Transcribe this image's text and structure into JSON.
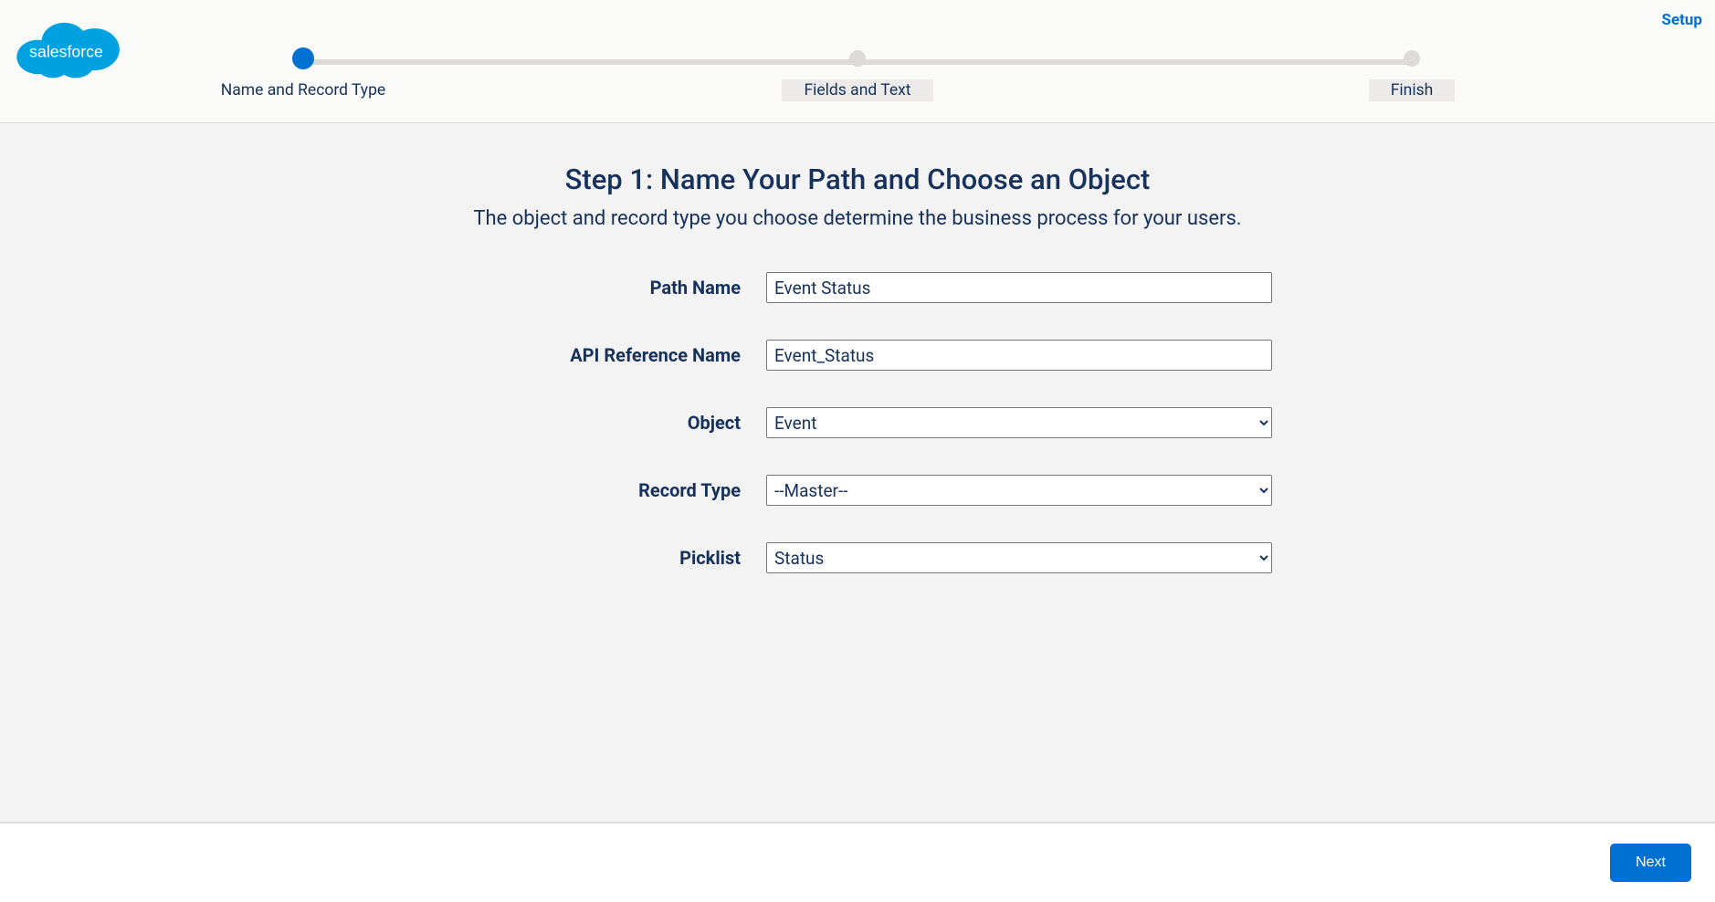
{
  "header": {
    "setup_link": "Setup",
    "logo_alt": "salesforce"
  },
  "progress": {
    "steps": [
      {
        "label": "Name and Record Type",
        "active": true
      },
      {
        "label": "Fields and Text",
        "active": false
      },
      {
        "label": "Finish",
        "active": false
      }
    ]
  },
  "main": {
    "title": "Step 1: Name Your Path and Choose an Object",
    "subtitle": "The object and record type you choose determine the business process for your users.",
    "fields": {
      "path_name": {
        "label": "Path Name",
        "value": "Event Status"
      },
      "api_name": {
        "label": "API Reference Name",
        "value": "Event_Status"
      },
      "object": {
        "label": "Object",
        "selected": "Event",
        "options": [
          "Event"
        ]
      },
      "record_type": {
        "label": "Record Type",
        "selected": "--Master--",
        "options": [
          "--Master--"
        ]
      },
      "picklist": {
        "label": "Picklist",
        "selected": "Status",
        "options": [
          "Status"
        ]
      }
    }
  },
  "footer": {
    "next_label": "Next"
  }
}
